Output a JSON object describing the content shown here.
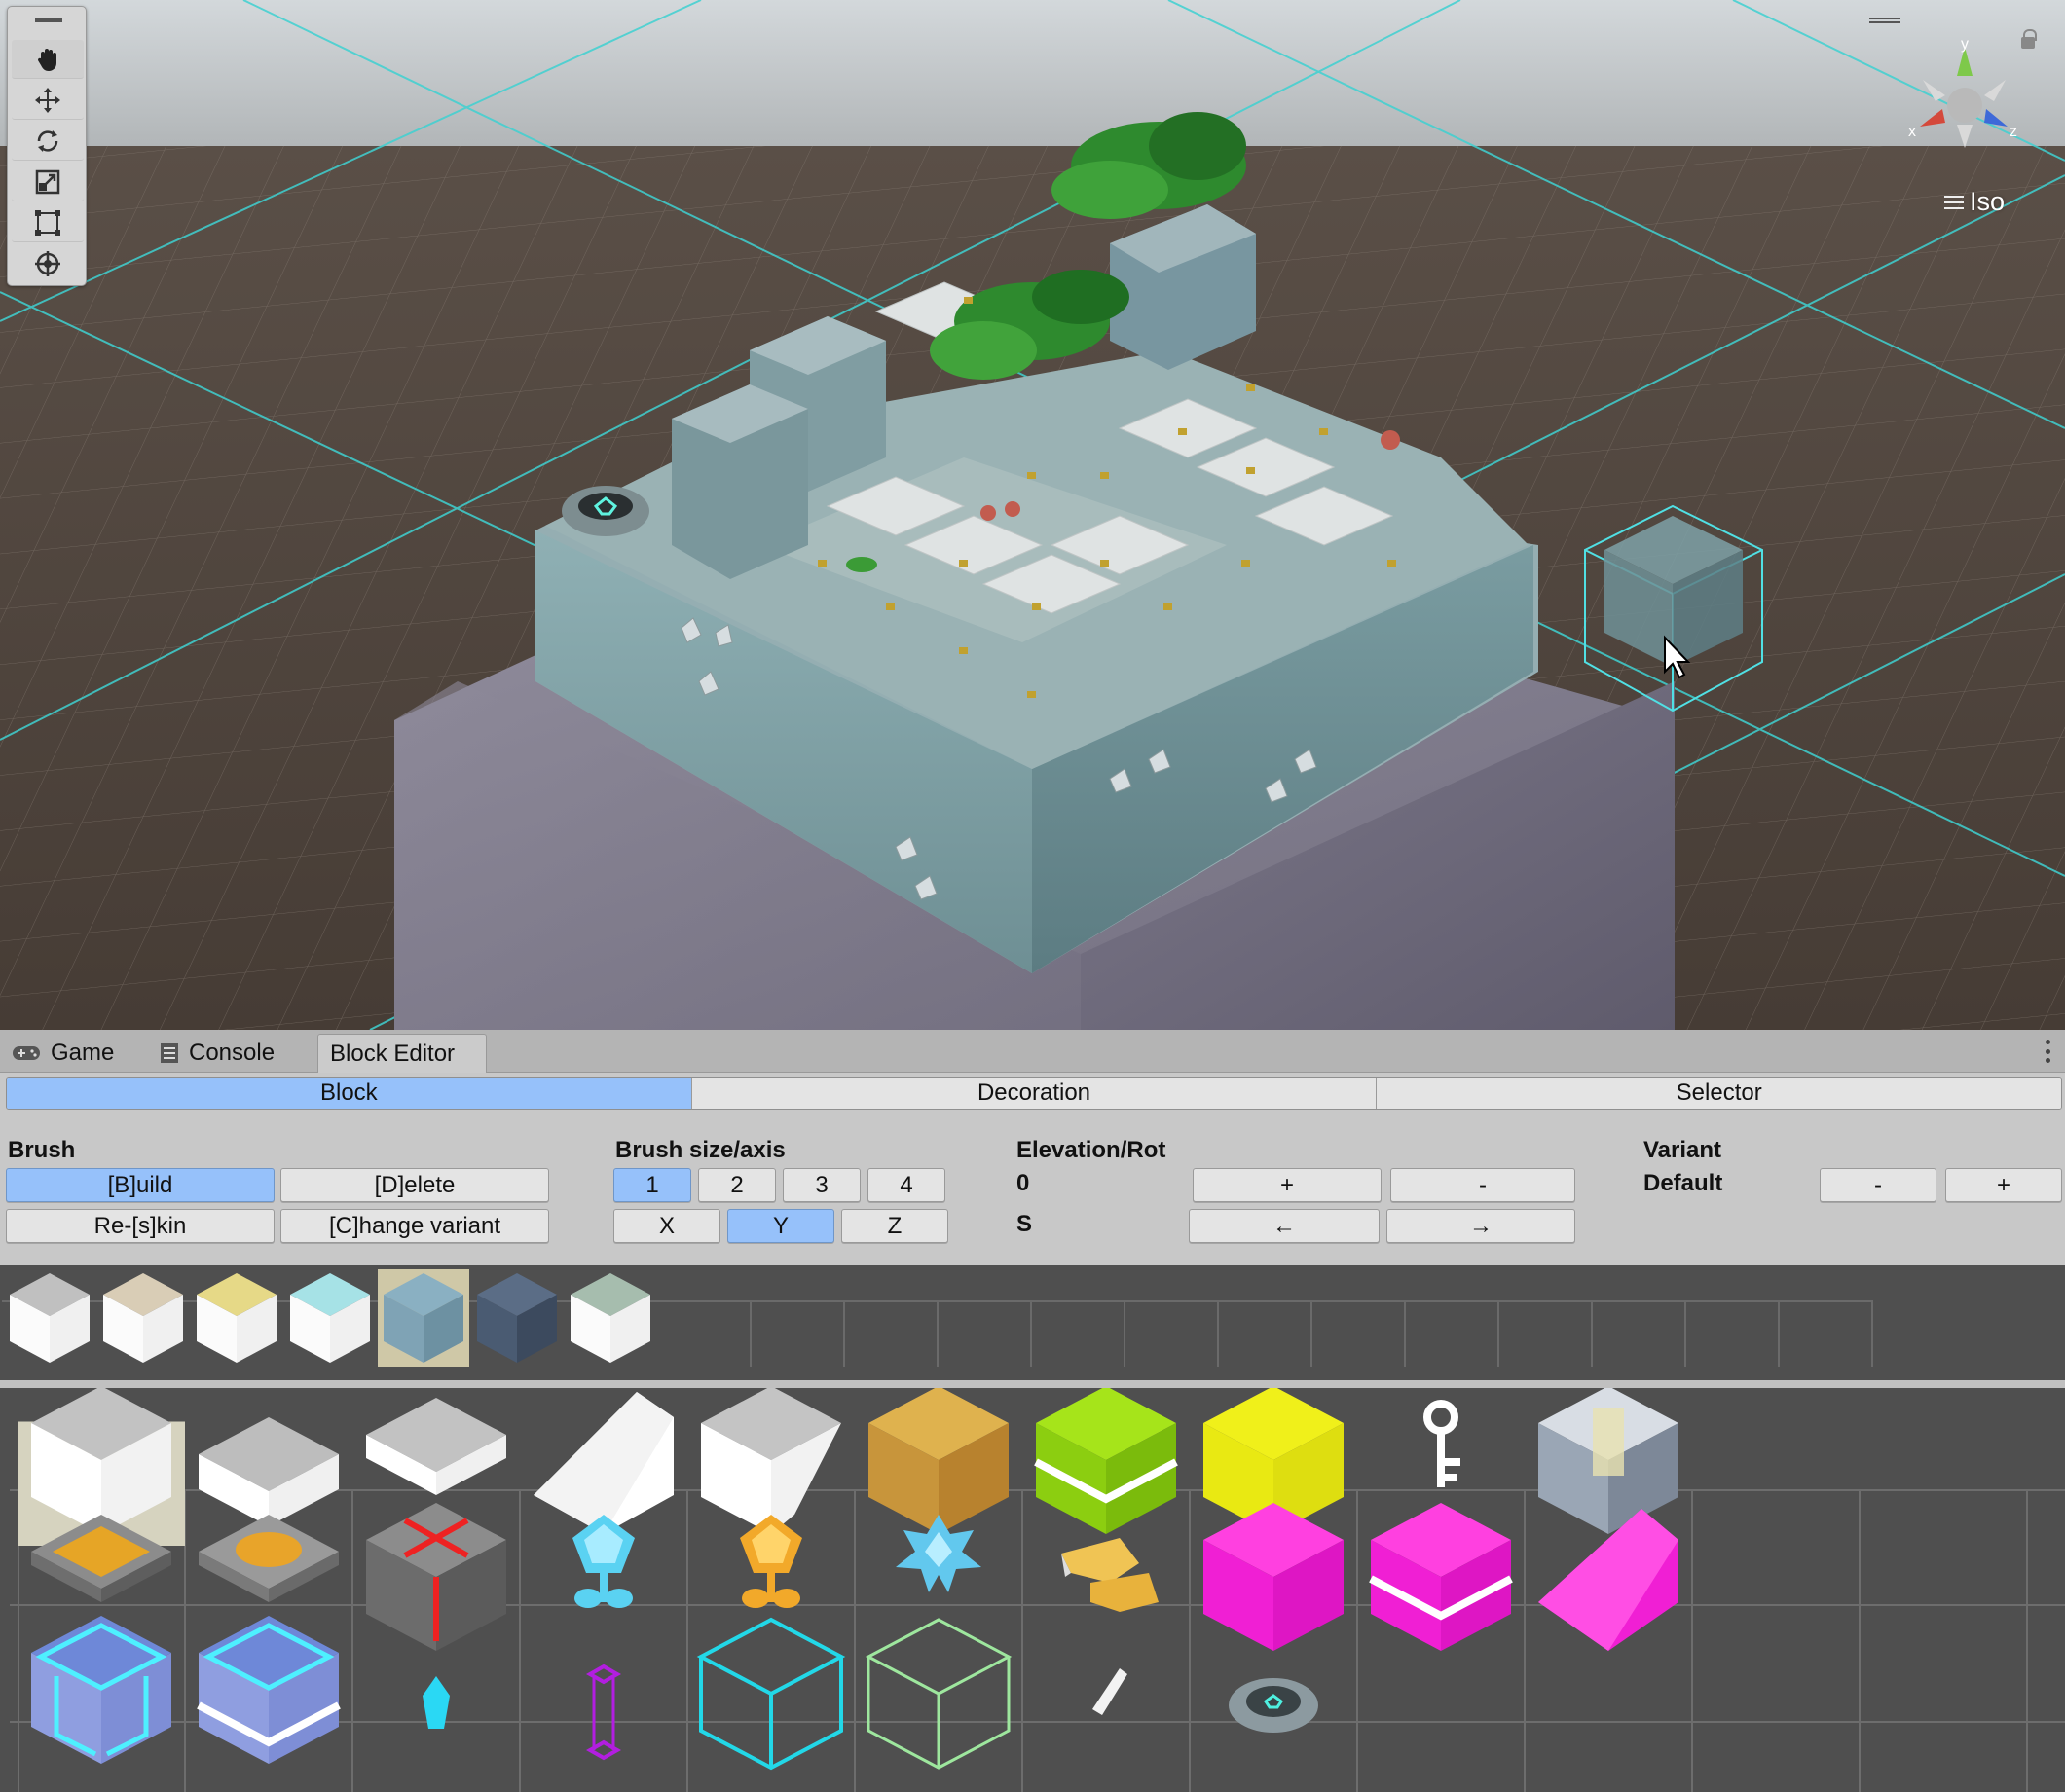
{
  "scene": {
    "view_mode_label": "Iso",
    "gizmo_axes": [
      "y",
      "x",
      "z"
    ]
  },
  "toolbar": {
    "tools": [
      "hand-tool",
      "move-tool",
      "rotate-tool",
      "scale-tool",
      "rect-tool",
      "transform-tool"
    ]
  },
  "tabs": [
    {
      "label": "Game",
      "icon": "gamepad-icon"
    },
    {
      "label": "Console",
      "icon": "console-icon"
    },
    {
      "label": "Block Editor",
      "icon": ""
    }
  ],
  "modes": [
    "Block",
    "Decoration",
    "Selector"
  ],
  "brush": {
    "title": "Brush",
    "build": "[B]uild",
    "delete": "[D]elete",
    "reskin": "Re-[s]kin",
    "change_variant": "[C]hange variant"
  },
  "brush_size": {
    "title": "Brush size/axis",
    "sizes": [
      "1",
      "2",
      "3",
      "4"
    ],
    "axes": [
      "X",
      "Y",
      "Z"
    ]
  },
  "elevation": {
    "title": "Elevation/Rot",
    "elevation_value": "0",
    "rotation_value": "S",
    "plus": "+",
    "minus": "-",
    "left": "←",
    "right": "→"
  },
  "variant": {
    "title": "Variant",
    "value": "Default",
    "minus": "-",
    "plus": "+"
  },
  "colors": {
    "accent_blue": "#96c1fa",
    "grid_cyan": "#33d0d0",
    "skin_colors": [
      "#c0c0c0",
      "#d9cdb6",
      "#e6d987",
      "#a6e2e6",
      "#8ab0c2",
      "#5b6d86",
      "#a6bdae"
    ]
  },
  "palette_items": [
    "white-cube",
    "white-slab",
    "white-thin-slab",
    "white-ramp",
    "white-corner-ramp",
    "gold-rock-cube",
    "green-cube",
    "yellow-cube",
    "key-item",
    "cage-block",
    "gold-pressure-plate",
    "orange-pressure-plate",
    "gift-box",
    "blue-crystal-flower",
    "orange-crystal-flower",
    "blue-star-crystal",
    "gold-bird",
    "magenta-cube",
    "magenta-slab",
    "magenta-ramp",
    "cyan-glass-cube",
    "cyan-glass-slab",
    "cyan-gem",
    "purple-pillar",
    "cyan-wire-cube",
    "green-wire-cube",
    "white-shard",
    "teleport-pad"
  ]
}
